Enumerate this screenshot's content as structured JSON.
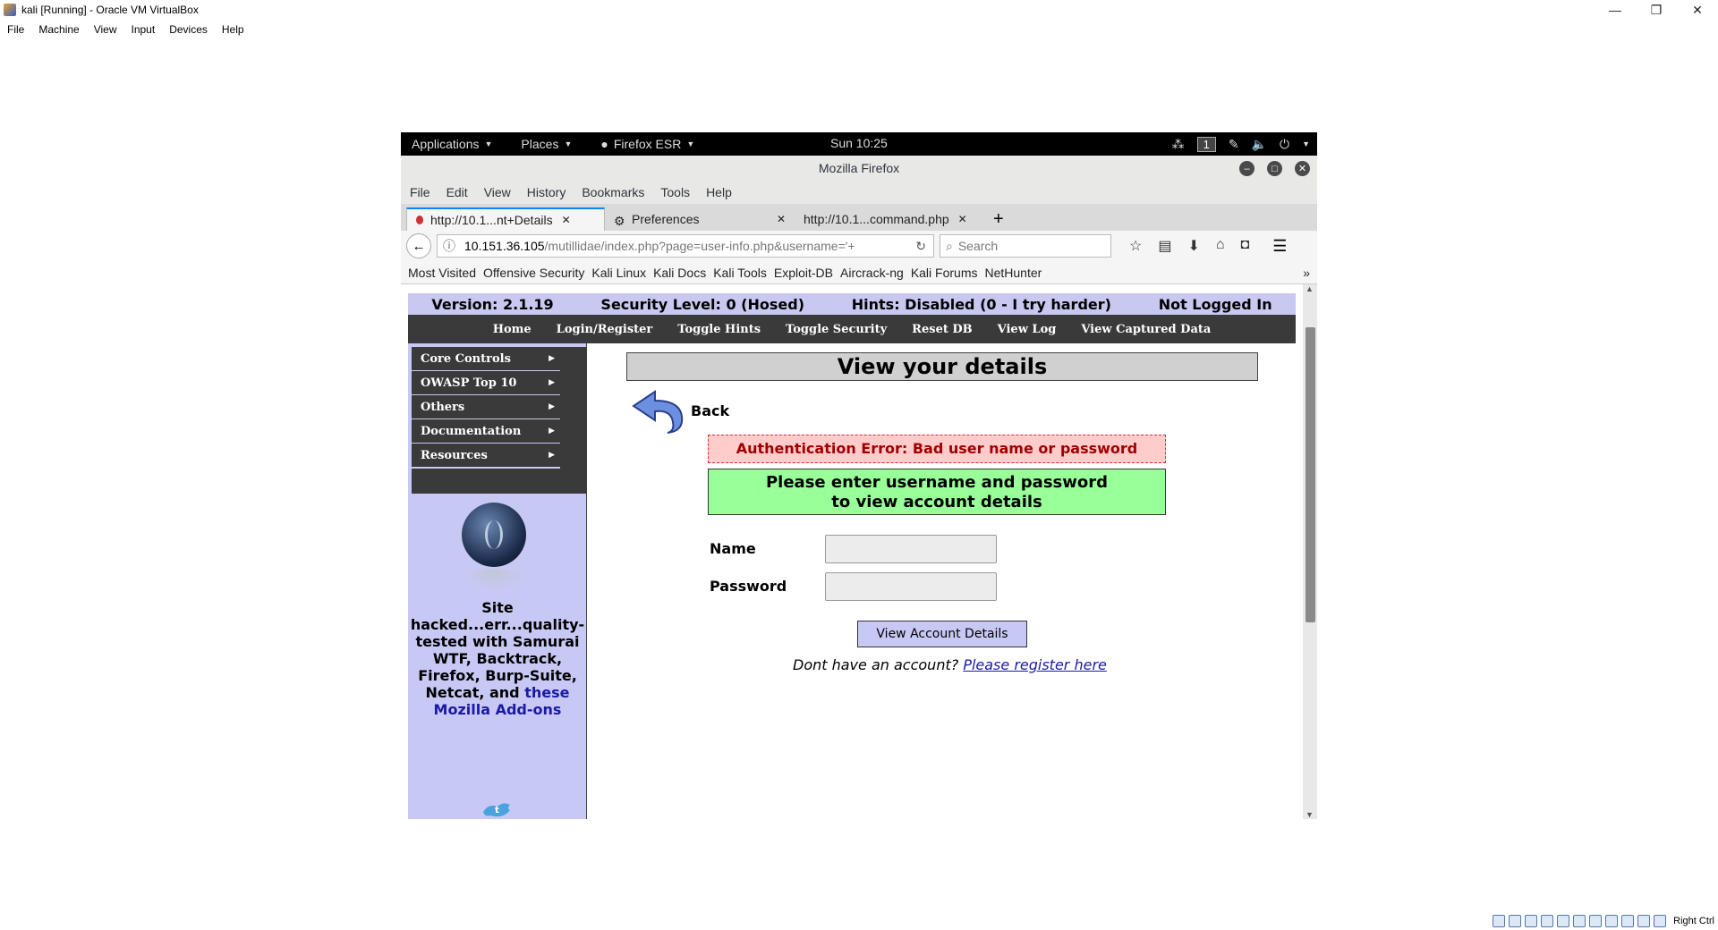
{
  "host": {
    "title": "kali [Running] - Oracle VM VirtualBox",
    "menu": [
      "File",
      "Machine",
      "View",
      "Input",
      "Devices",
      "Help"
    ],
    "window_controls": [
      "—",
      "❐",
      "✕"
    ],
    "status_host_key": "Right Ctrl"
  },
  "gnome": {
    "applications": "Applications",
    "places": "Places",
    "firefox": "Firefox ESR",
    "clock": "Sun 10:25",
    "workspace": "1"
  },
  "firefox": {
    "window_title": "Mozilla Firefox",
    "menu": [
      "File",
      "Edit",
      "View",
      "History",
      "Bookmarks",
      "Tools",
      "Help"
    ],
    "tabs": [
      {
        "label": "http://10.1...nt+Details",
        "active": true
      },
      {
        "label": "Preferences",
        "active": false
      },
      {
        "label": "http://10.1...command.php",
        "active": false
      }
    ],
    "url_host": "10.151.36.105",
    "url_path": "/mutillidae/index.php?page=user-info.php&username='+",
    "search_placeholder": "Search",
    "bookmarks": [
      "Most Visited",
      "Offensive Security",
      "Kali Linux",
      "Kali Docs",
      "Kali Tools",
      "Exploit-DB",
      "Aircrack-ng",
      "Kali Forums",
      "NetHunter"
    ]
  },
  "page": {
    "status": {
      "version": "Version: 2.1.19",
      "security": "Security Level: 0 (Hosed)",
      "hints": "Hints: Disabled (0 - I try harder)",
      "login": "Not Logged In"
    },
    "nav": [
      "Home",
      "Login/Register",
      "Toggle Hints",
      "Toggle Security",
      "Reset DB",
      "View Log",
      "View Captured Data"
    ],
    "side_menu": [
      "Core Controls",
      "OWASP Top 10",
      "Others",
      "Documentation",
      "Resources"
    ],
    "hacked_text": "Site hacked...err...quality-tested with Samurai WTF, Backtrack, Firefox, Burp-Suite, Netcat, and",
    "hacked_link": "these Mozilla Add-ons",
    "title": "View your details",
    "back": "Back",
    "auth_error": "Authentication Error: Bad user name or password",
    "prompt_line1": "Please enter username and password",
    "prompt_line2": "to view account details",
    "name_label": "Name",
    "password_label": "Password",
    "name_value": "",
    "password_value": "",
    "submit": "View Account Details",
    "register_prefix": "Dont have an account?",
    "register_link": "Please register here"
  }
}
